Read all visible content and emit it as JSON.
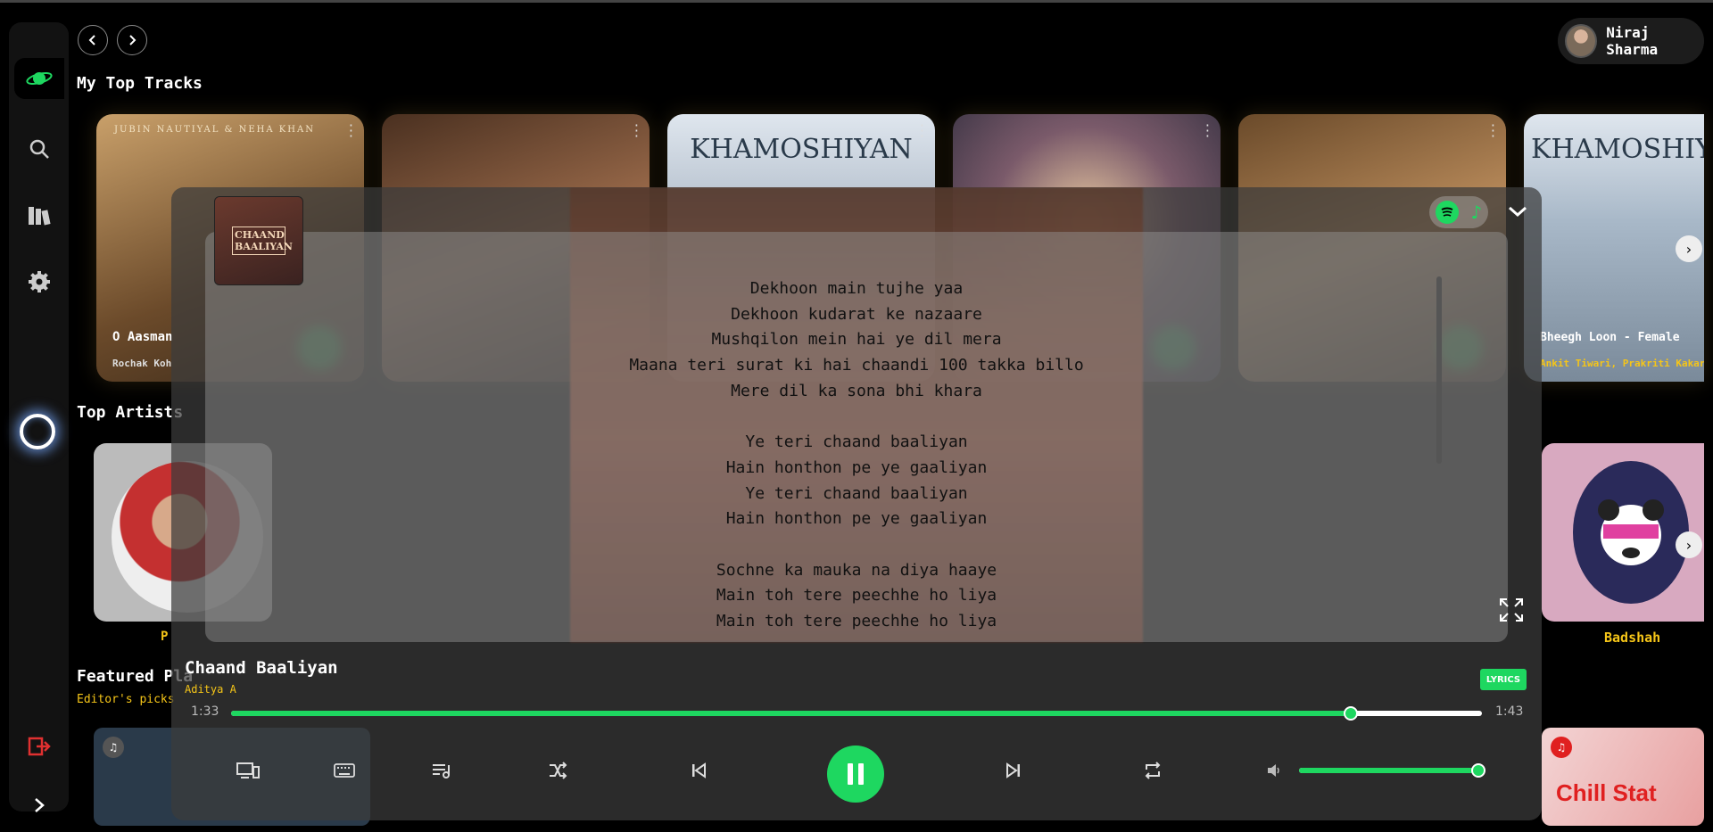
{
  "user": {
    "name": "Niraj Sharma"
  },
  "sections": {
    "top_tracks": "My Top Tracks",
    "top_artists": "Top Artists",
    "featured": "Featured Pla",
    "featured_sub": "Editor's picks"
  },
  "tracks": [
    {
      "caption": "O Aasman",
      "sub": "Rochak Koh",
      "banner": "JUBIN NAUTIYAL & NEHA KHAN"
    },
    {
      "caption": "",
      "sub": "",
      "banner": ""
    },
    {
      "caption": "",
      "sub": "",
      "banner": "KHAMOSHIYAN"
    },
    {
      "caption": "",
      "sub": "",
      "banner": ""
    },
    {
      "caption": "",
      "sub": "",
      "banner": ""
    },
    {
      "caption": "Bheegh Loon - Female",
      "sub": "Ankit Tiwari, Prakriti Kakar",
      "banner": "KHAMOSHIY"
    }
  ],
  "artists": [
    {
      "name": "P"
    },
    {
      "name": "Badshah"
    }
  ],
  "playlists": [
    {
      "title": "Chill Stat"
    }
  ],
  "player": {
    "cover_text": "CHAAND BAALIYAN",
    "song_title": "Chaand Baaliyan",
    "artist": "Aditya A",
    "lyrics_button": "LYRICS",
    "elapsed": "1:33",
    "duration": "1:43",
    "progress": 0.895,
    "volume": 0.98,
    "lyrics": [
      [
        "Dekhoon main tujhe yaa",
        "Dekhoon kudarat ke nazaare",
        "Mushqilon mein hai ye dil mera",
        "Maana teri surat ki hai chaandi 100 takka billo",
        "Mere dil ka sona bhi khara"
      ],
      [
        "Ye teri chaand baaliyan",
        "Hain honthon pe ye gaaliyan",
        "Ye teri chaand baaliyan",
        "Hain honthon pe ye gaaliyan"
      ],
      [
        "Sochne ka mauka na diya haaye",
        "Main toh tere peechhe ho liya",
        "Main toh tere peechhe ho liya"
      ]
    ]
  },
  "colors": {
    "accent": "#1ed760",
    "artist_gold": "#f5c518",
    "rail": "#121212"
  }
}
